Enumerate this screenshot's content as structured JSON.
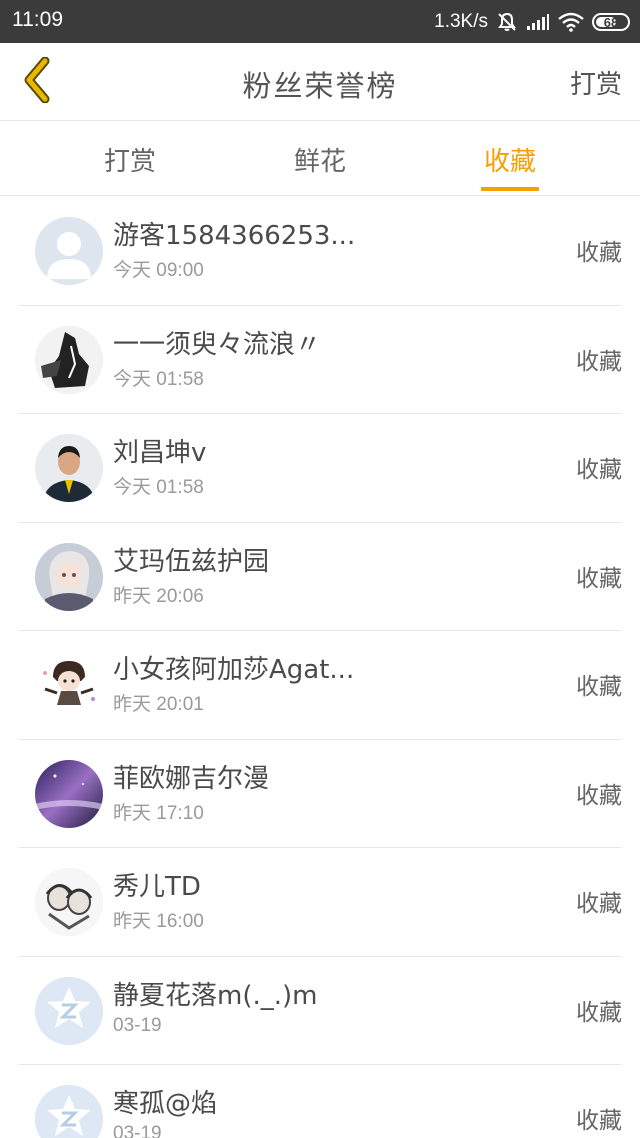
{
  "status_bar": {
    "time": "11:09",
    "network_speed": "1.3K/s",
    "battery": "68",
    "icons": [
      "mute-icon",
      "signal-icon",
      "wifi-icon",
      "battery-icon"
    ]
  },
  "header": {
    "title": "粉丝荣誉榜",
    "action_label": "打赏",
    "back_icon": "chevron-left-icon",
    "back_color": "#e8a800"
  },
  "tabs": [
    {
      "label": "打赏",
      "active": false
    },
    {
      "label": "鲜花",
      "active": false
    },
    {
      "label": "收藏",
      "active": true
    }
  ],
  "colors": {
    "accent": "#f5a000",
    "status_bar": "#3b3b3b"
  },
  "list": [
    {
      "name": "游客1584366253...",
      "time": "今天 09:00",
      "action": "收藏",
      "avatar": "default-person-avatar"
    },
    {
      "name": "一一须臾々流浪〃",
      "time": "今天 01:58",
      "action": "收藏",
      "avatar": "ink-art-avatar"
    },
    {
      "name": "刘昌坤v",
      "time": "今天 01:58",
      "action": "收藏",
      "avatar": "photo-man-avatar"
    },
    {
      "name": "艾玛伍兹护园",
      "time": "昨天 20:06",
      "action": "收藏",
      "avatar": "anime-girl-avatar"
    },
    {
      "name": "小女孩阿加莎Agat...",
      "time": "昨天 20:01",
      "action": "收藏",
      "avatar": "chibi-avatar"
    },
    {
      "name": "菲欧娜吉尔漫",
      "time": "昨天 17:10",
      "action": "收藏",
      "avatar": "galaxy-avatar"
    },
    {
      "name": "秀儿TD",
      "time": "昨天 16:00",
      "action": "收藏",
      "avatar": "sketch-avatar"
    },
    {
      "name": "静夏花落m(._.)m",
      "time": "03-19",
      "action": "收藏",
      "avatar": "default-z-avatar"
    },
    {
      "name": "寒孤@焰",
      "time": "03-19",
      "action": "收藏",
      "avatar": "default-z-avatar"
    }
  ]
}
